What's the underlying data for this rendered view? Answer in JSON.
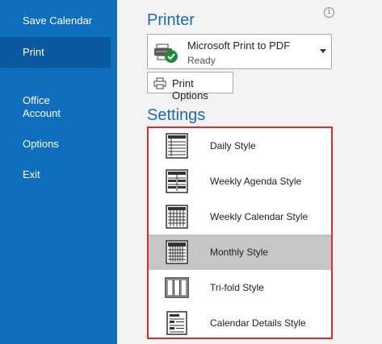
{
  "sidebar": {
    "items": [
      {
        "label": "Save Calendar"
      },
      {
        "label": "Print"
      },
      {
        "label": "Office\nAccount"
      },
      {
        "label": "Options"
      },
      {
        "label": "Exit"
      }
    ]
  },
  "printer": {
    "section_title": "Printer",
    "name": "Microsoft Print to PDF",
    "status": "Ready",
    "options_label": "Print Options"
  },
  "settings": {
    "section_title": "Settings",
    "styles": [
      {
        "label": "Daily Style",
        "icon": "daily-style-icon"
      },
      {
        "label": "Weekly Agenda Style",
        "icon": "weekly-agenda-style-icon"
      },
      {
        "label": "Weekly Calendar Style",
        "icon": "weekly-calendar-style-icon"
      },
      {
        "label": "Monthly Style",
        "icon": "monthly-style-icon",
        "selected": true
      },
      {
        "label": "Tri-fold Style",
        "icon": "tri-fold-style-icon"
      },
      {
        "label": "Calendar Details Style",
        "icon": "calendar-details-style-icon"
      }
    ]
  },
  "colors": {
    "sidebar": "#106ebe",
    "accent_title": "#1e69b8",
    "highlight_border": "#e02b2b",
    "selected_row": "#c6c6c6"
  }
}
